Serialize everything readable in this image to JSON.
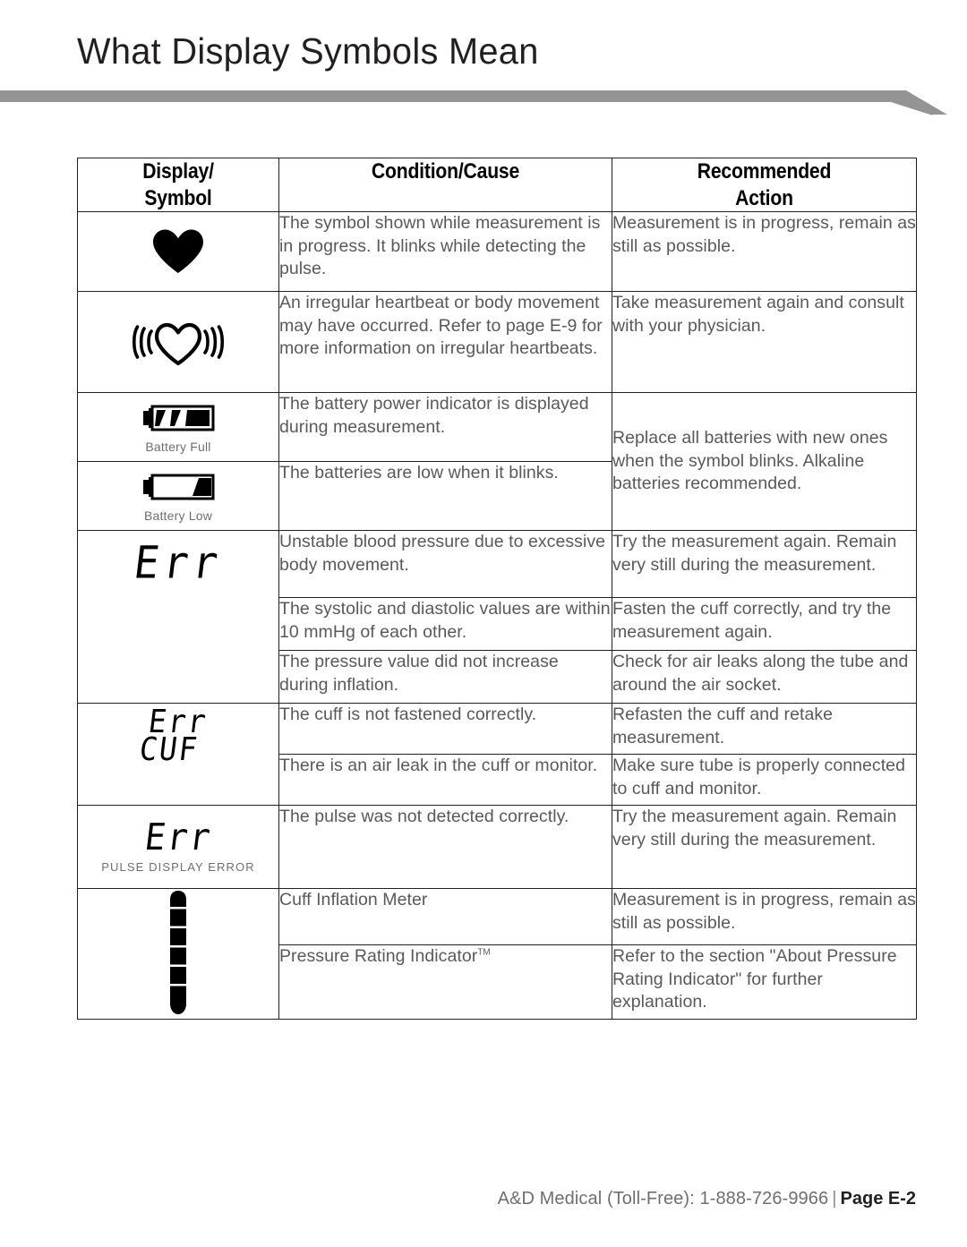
{
  "page": {
    "title": "What Display Symbols Mean",
    "rule_color": "#949494"
  },
  "table": {
    "headers": {
      "display_symbol_line1": "Display/",
      "display_symbol_line2": "Symbol",
      "condition_cause": "Condition/Cause",
      "recommended_line1": "Recommended",
      "recommended_line2": "Action"
    },
    "rows": [
      {
        "symbol": "filled-heart-icon",
        "caption": "",
        "condition": "The symbol shown while measurement is in progress. It blinks while detecting the pulse.",
        "action": "Measurement is in progress, remain as still as possible."
      },
      {
        "symbol": "pulsing-heart-icon",
        "caption": "",
        "condition": "An irregular heartbeat or body movement may have occurred. Refer to page E-9 for more information on irregular heartbeats.",
        "action": "Take measurement again and consult with your physician."
      },
      {
        "symbol": "battery-full-icon",
        "caption": "Battery Full",
        "condition": "The battery power indicator is displayed during measurement.",
        "action": "Replace all batteries with new ones when the symbol blinks. Alkaline batteries recommended."
      },
      {
        "symbol": "battery-low-icon",
        "caption": "Battery Low",
        "condition": "The batteries are low when it blinks.",
        "action": ""
      },
      {
        "symbol": "Err",
        "caption": "",
        "condition": "Unstable blood pressure due to excessive body movement.",
        "action": "Try the measurement again. Remain very still during the measurement."
      },
      {
        "symbol": "",
        "caption": "",
        "condition": "The systolic and diastolic values are within 10 mmHg of each other.",
        "action": "Fasten the cuff correctly, and try the measurement again."
      },
      {
        "symbol": "",
        "caption": "",
        "condition": "The pressure value did not increase during inflation.",
        "action": "Check for air leaks along the tube and around the air socket."
      },
      {
        "symbol_line1": "Err",
        "symbol_line2": "CUF",
        "caption": "",
        "condition": "The cuff is not fastened correctly.",
        "action": "Refasten the cuff and retake measurement."
      },
      {
        "symbol": "",
        "caption": "",
        "condition": "There is an air leak in the cuff or monitor.",
        "action": "Make sure tube is properly connected to cuff and monitor."
      },
      {
        "symbol": "Err",
        "caption": "PULSE DISPLAY ERROR",
        "condition": "The pulse was not detected correctly.",
        "action": "Try the measurement again. Remain very still during the measurement."
      },
      {
        "symbol": "inflation-bar-icon",
        "caption": "",
        "condition": "Cuff Inflation Meter",
        "action": "Measurement is in progress, remain as still as possible."
      },
      {
        "symbol": "",
        "caption": "",
        "condition": "Pressure Rating Indicator",
        "condition_superscript": "TM",
        "action": "Refer to the section \"About Pressure Rating Indicator\" for further explanation."
      }
    ]
  },
  "footer": {
    "contact": "A&D Medical (Toll-Free): 1-888-726-9966",
    "separator": "|",
    "page_number": "Page E-2"
  }
}
